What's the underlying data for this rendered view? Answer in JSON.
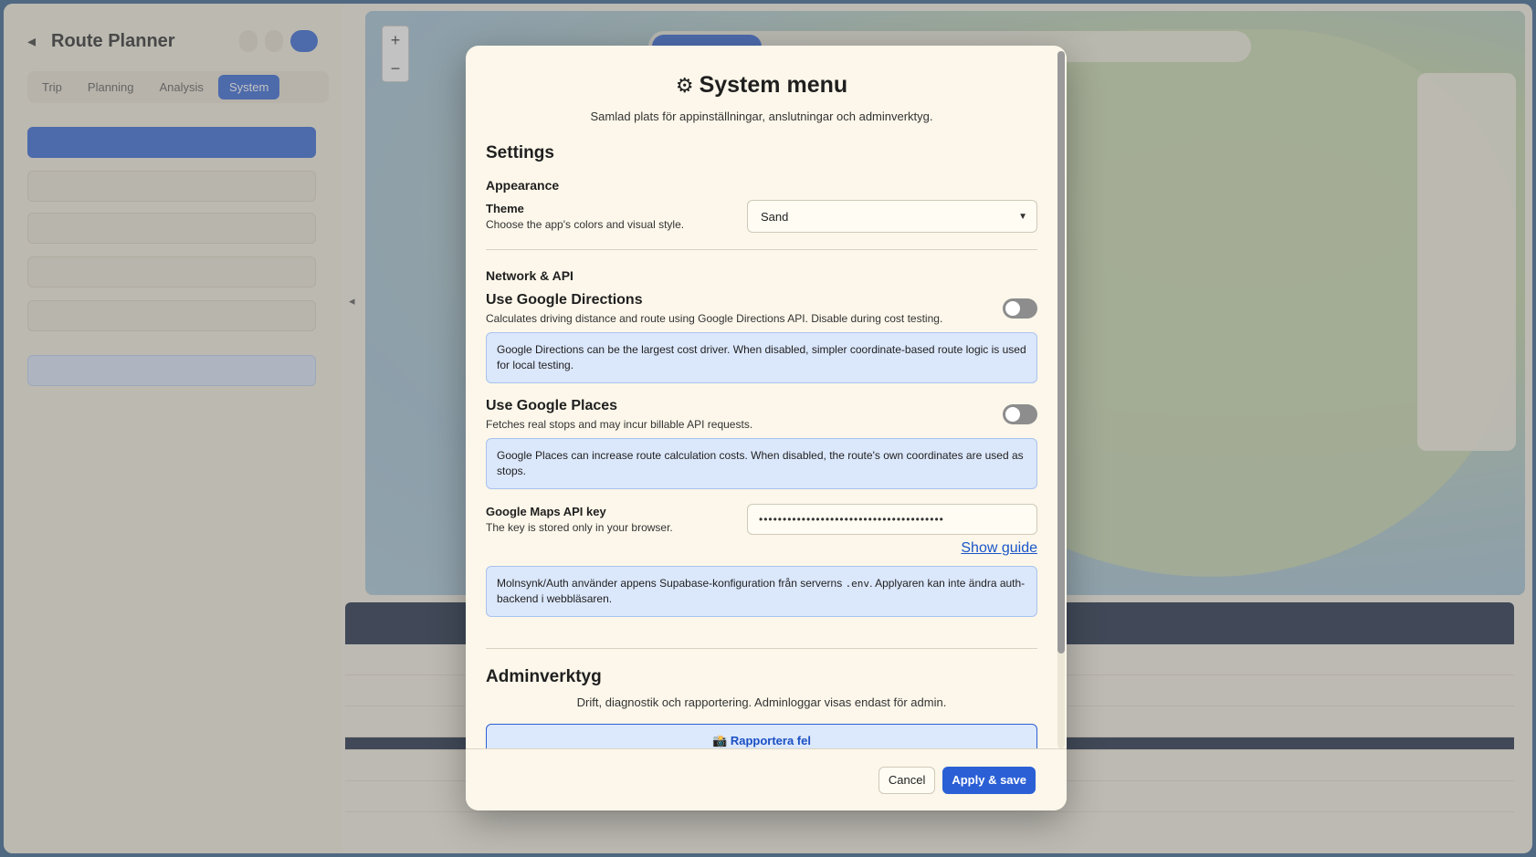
{
  "background_app": {
    "title": "Route Planner",
    "tabs": [
      "Trip",
      "Planning",
      "Analysis",
      "System"
    ],
    "active_tab": "System"
  },
  "modal": {
    "icon": "gear-icon",
    "title": "System menu",
    "subtitle": "Samlad plats för appinställningar, anslutningar och adminverktyg.",
    "settings_heading": "Settings",
    "appearance": {
      "heading": "Appearance",
      "theme_label": "Theme",
      "theme_desc": "Choose the app's colors and visual style.",
      "theme_value": "Sand"
    },
    "network": {
      "heading": "Network & API",
      "directions": {
        "title": "Use Google Directions",
        "desc": "Calculates driving distance and route using Google Directions API. Disable during cost testing.",
        "enabled": false,
        "info": "Google Directions can be the largest cost driver. When disabled, simpler coordinate-based route logic is used for local testing."
      },
      "places": {
        "title": "Use Google Places",
        "desc": "Fetches real stops and may incur billable API requests.",
        "enabled": false,
        "info": "Google Places can increase route calculation costs. When disabled, the route's own coordinates are used as stops."
      },
      "api_key": {
        "label": "Google Maps API key",
        "desc": "The key is stored only in your browser.",
        "value": "•••••••••••••••••••••••••••••••••••••••"
      },
      "guide_link": "Show guide",
      "auth_info_pre": "Molnsynk/Auth använder appens Supabase-konfiguration från serverns ",
      "auth_info_code": ".env",
      "auth_info_post": ". Applyaren kan inte ändra auth-backend i webbläsaren."
    },
    "admin": {
      "heading": "Adminverktyg",
      "subtitle": "Drift, diagnostik och rapportering. Adminloggar visas endast för admin.",
      "report_button": "📸 Rapportera fel"
    },
    "footer": {
      "cancel": "Cancel",
      "apply": "Apply & save"
    }
  },
  "colors": {
    "accent": "#2b5fd6",
    "modal_bg": "#fcf7ea",
    "info_bg": "#dbe7fb",
    "toggle_off": "#8d8d8d"
  }
}
